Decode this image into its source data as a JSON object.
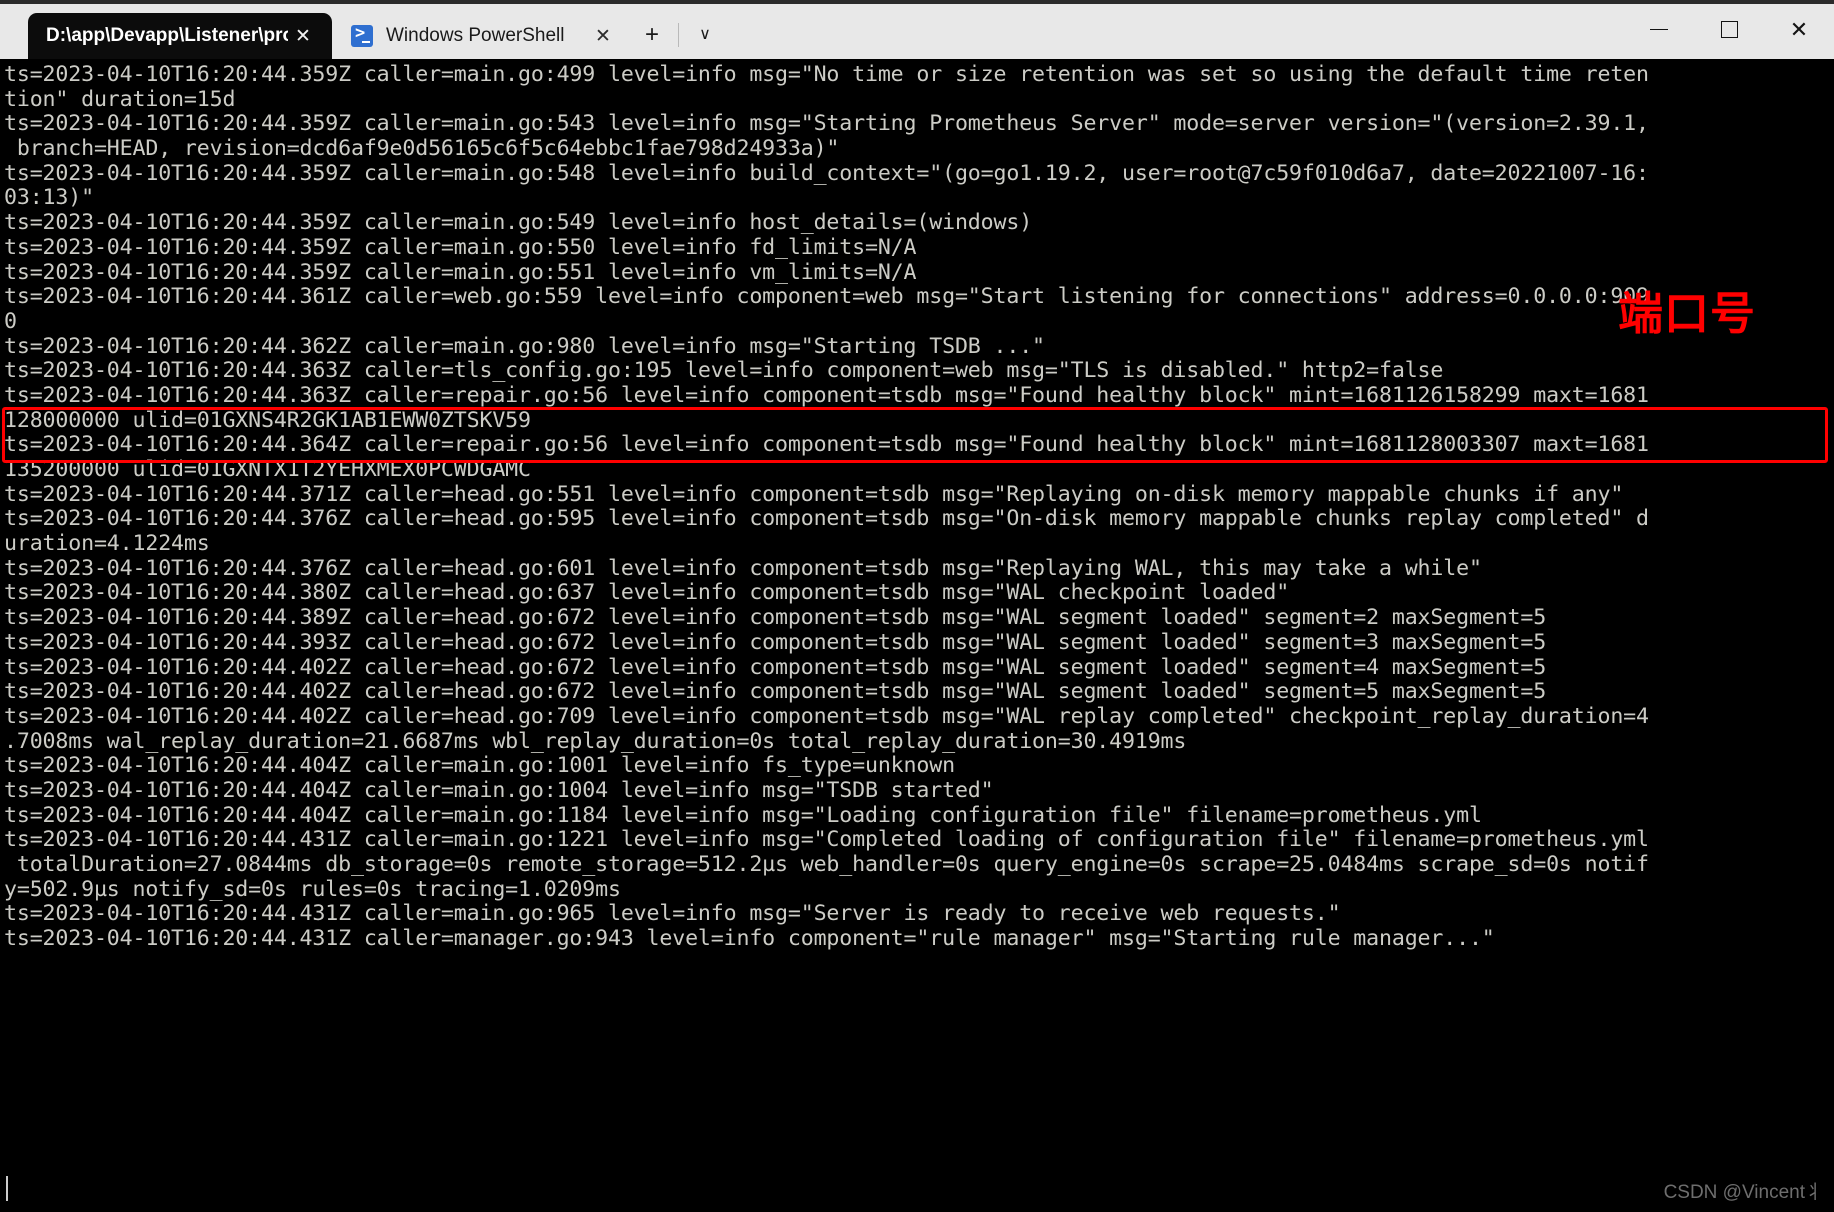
{
  "window": {
    "tabs": [
      {
        "id": "tab-prometheus",
        "title": "D:\\app\\Devapp\\Listener\\prom",
        "icon": "terminal-icon",
        "active": true,
        "close_label": "✕"
      },
      {
        "id": "tab-powershell",
        "title": "Windows PowerShell",
        "icon": "powershell-icon",
        "active": false,
        "close_label": "✕"
      }
    ],
    "new_tab_label": "+",
    "dropdown_label": "∨",
    "controls": {
      "minimize_label": "—",
      "maximize_label": "□",
      "close_label": "✕"
    }
  },
  "console": {
    "foreground_color": "#ccccc6",
    "background_color": "#000000",
    "lines": [
      "ts=2023-04-10T16:20:44.359Z caller=main.go:499 level=info msg=\"No time or size retention was set so using the default time reten",
      "tion\" duration=15d",
      "ts=2023-04-10T16:20:44.359Z caller=main.go:543 level=info msg=\"Starting Prometheus Server\" mode=server version=\"(version=2.39.1,",
      " branch=HEAD, revision=dcd6af9e0d56165c6f5c64ebbc1fae798d24933a)\"",
      "ts=2023-04-10T16:20:44.359Z caller=main.go:548 level=info build_context=\"(go=go1.19.2, user=root@7c59f010d6a7, date=20221007-16:",
      "03:13)\"",
      "ts=2023-04-10T16:20:44.359Z caller=main.go:549 level=info host_details=(windows)",
      "ts=2023-04-10T16:20:44.359Z caller=main.go:550 level=info fd_limits=N/A",
      "ts=2023-04-10T16:20:44.359Z caller=main.go:551 level=info vm_limits=N/A",
      "ts=2023-04-10T16:20:44.361Z caller=web.go:559 level=info component=web msg=\"Start listening for connections\" address=0.0.0.0:909",
      "0",
      "ts=2023-04-10T16:20:44.362Z caller=main.go:980 level=info msg=\"Starting TSDB ...\"",
      "ts=2023-04-10T16:20:44.363Z caller=tls_config.go:195 level=info component=web msg=\"TLS is disabled.\" http2=false",
      "ts=2023-04-10T16:20:44.363Z caller=repair.go:56 level=info component=tsdb msg=\"Found healthy block\" mint=1681126158299 maxt=1681",
      "128000000 ulid=01GXNS4R2GK1AB1EWW0ZTSKV59",
      "ts=2023-04-10T16:20:44.364Z caller=repair.go:56 level=info component=tsdb msg=\"Found healthy block\" mint=1681128003307 maxt=1681",
      "135200000 ulid=01GXNTX1T2YEHXMEX0PCWDGAMC",
      "ts=2023-04-10T16:20:44.371Z caller=head.go:551 level=info component=tsdb msg=\"Replaying on-disk memory mappable chunks if any\"",
      "ts=2023-04-10T16:20:44.376Z caller=head.go:595 level=info component=tsdb msg=\"On-disk memory mappable chunks replay completed\" d",
      "uration=4.1224ms",
      "ts=2023-04-10T16:20:44.376Z caller=head.go:601 level=info component=tsdb msg=\"Replaying WAL, this may take a while\"",
      "ts=2023-04-10T16:20:44.380Z caller=head.go:637 level=info component=tsdb msg=\"WAL checkpoint loaded\"",
      "ts=2023-04-10T16:20:44.389Z caller=head.go:672 level=info component=tsdb msg=\"WAL segment loaded\" segment=2 maxSegment=5",
      "ts=2023-04-10T16:20:44.393Z caller=head.go:672 level=info component=tsdb msg=\"WAL segment loaded\" segment=3 maxSegment=5",
      "ts=2023-04-10T16:20:44.402Z caller=head.go:672 level=info component=tsdb msg=\"WAL segment loaded\" segment=4 maxSegment=5",
      "ts=2023-04-10T16:20:44.402Z caller=head.go:672 level=info component=tsdb msg=\"WAL segment loaded\" segment=5 maxSegment=5",
      "ts=2023-04-10T16:20:44.402Z caller=head.go:709 level=info component=tsdb msg=\"WAL replay completed\" checkpoint_replay_duration=4",
      ".7008ms wal_replay_duration=21.6687ms wbl_replay_duration=0s total_replay_duration=30.4919ms",
      "ts=2023-04-10T16:20:44.404Z caller=main.go:1001 level=info fs_type=unknown",
      "ts=2023-04-10T16:20:44.404Z caller=main.go:1004 level=info msg=\"TSDB started\"",
      "ts=2023-04-10T16:20:44.404Z caller=main.go:1184 level=info msg=\"Loading configuration file\" filename=prometheus.yml",
      "ts=2023-04-10T16:20:44.431Z caller=main.go:1221 level=info msg=\"Completed loading of configuration file\" filename=prometheus.yml",
      " totalDuration=27.0844ms db_storage=0s remote_storage=512.2µs web_handler=0s query_engine=0s scrape=25.0484ms scrape_sd=0s notif",
      "y=502.9µs notify_sd=0s rules=0s tracing=1.0209ms",
      "ts=2023-04-10T16:20:44.431Z caller=main.go:965 level=info msg=\"Server is ready to receive web requests.\"",
      "ts=2023-04-10T16:20:44.431Z caller=manager.go:943 level=info component=\"rule manager\" msg=\"Starting rule manager...\""
    ]
  },
  "annotations": {
    "port_label": "端口号",
    "port_label_color": "#ff0000",
    "highlight_color": "#ff0000",
    "highlighted_line_index": 9,
    "highlighted_value": "address=0.0.0.0:9090"
  },
  "watermark": {
    "text": "CSDN @Vincent丬"
  }
}
